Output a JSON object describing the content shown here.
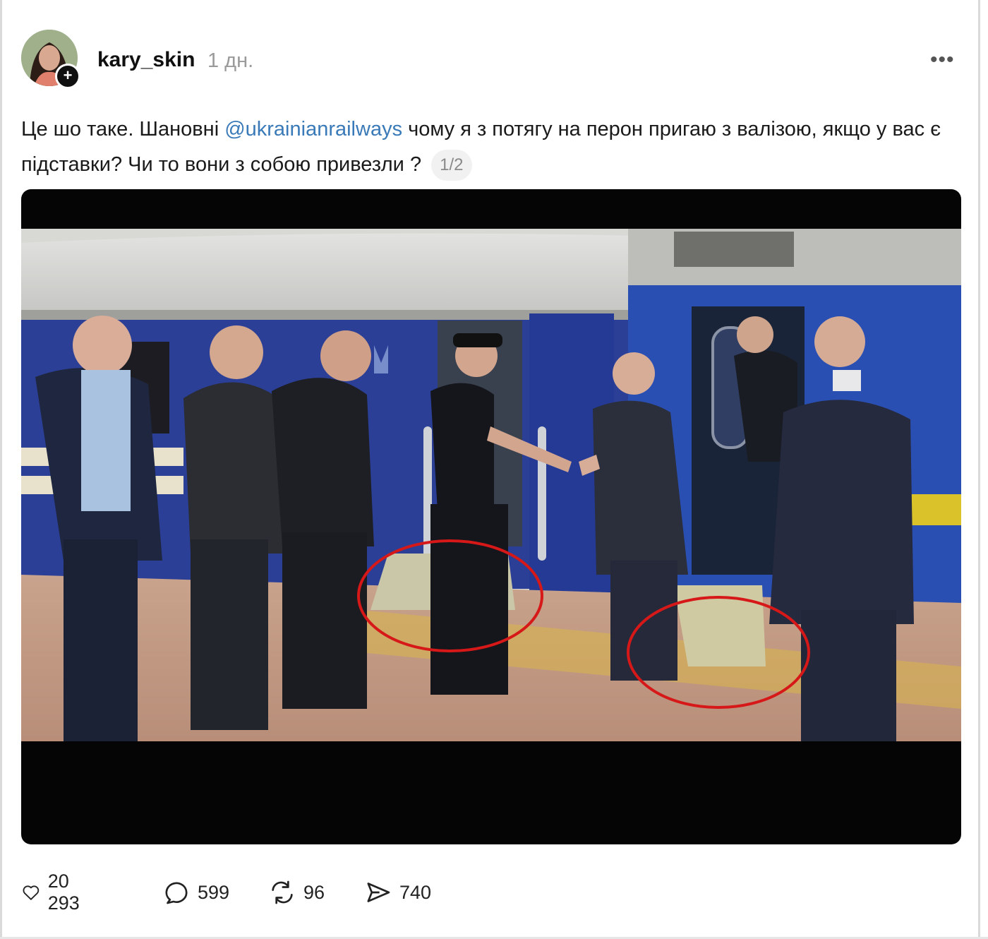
{
  "post": {
    "username": "kary_skin",
    "time": "1 дн.",
    "follow_symbol": "+",
    "more_symbol": "•••",
    "text_before": "Це шо таке. Шановні ",
    "mention": "@ukrainianrailways",
    "text_after": " чому я з потягу на перон пригаю з валізою, якщо у вас є підставки? Чи то вони з собою привезли ?",
    "pager": "1/2"
  },
  "media": {
    "description_icon": "video-frame"
  },
  "actions": {
    "likes": "20 293",
    "comments": "599",
    "reposts": "96",
    "shares": "740"
  },
  "colors": {
    "mention": "#3a7ab8",
    "annotation_circle": "#d61818",
    "train_blue": "#2b47a8"
  }
}
